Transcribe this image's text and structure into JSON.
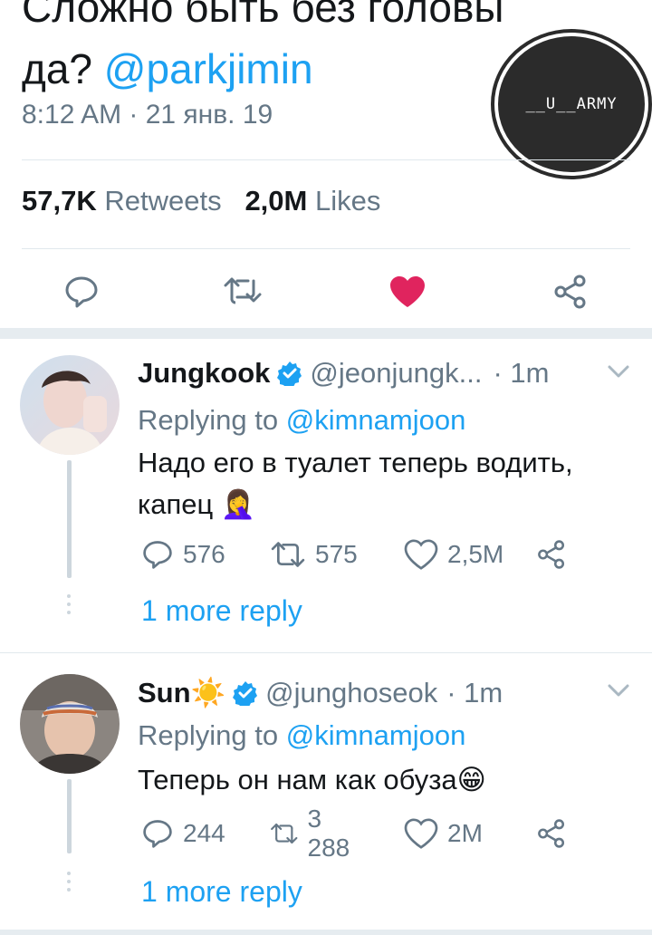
{
  "tweet": {
    "text": "Сложно быть без головы да?",
    "mention": "@parkjimin",
    "timestamp": "8:12 AM · 21 янв. 19",
    "retweets_count": "57,7K",
    "retweets_label": "Retweets",
    "likes_count": "2,0M",
    "likes_label": "Likes",
    "liked": true
  },
  "watermark": {
    "text": "__U__ARMY"
  },
  "replies": [
    {
      "name": "Jungkook",
      "handle": "@jeonjungk...",
      "time": "· 1m",
      "replying_prefix": "Replying to",
      "replying_to": "@kimnamjoon",
      "text": "Надо его в туалет теперь водить, капец 🤦‍♀️",
      "replies": "576",
      "retweets": "575",
      "likes": "2,5M",
      "more_label": "1 more reply"
    },
    {
      "name": "Sun☀️",
      "handle": "@junghoseok",
      "time": "· 1m",
      "replying_prefix": "Replying to",
      "replying_to": "@kimnamjoon",
      "text": "Теперь он нам как обуза😁",
      "replies": "244",
      "retweets": "3 288",
      "likes": "2M",
      "more_label": "1 more reply"
    }
  ],
  "colors": {
    "accent": "#1da1f2",
    "like": "#e0245e",
    "muted": "#657786",
    "verified": "#1da1f2"
  }
}
